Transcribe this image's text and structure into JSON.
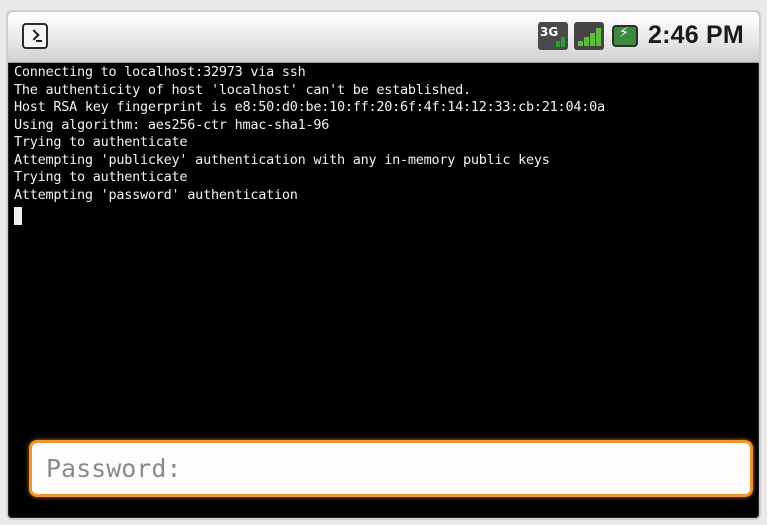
{
  "status_bar": {
    "notification_icon": "terminal-icon",
    "network_label": "3G",
    "signal_icon": "signal-bars-icon",
    "battery_icon": "battery-charging-icon",
    "time": "2:46 PM"
  },
  "terminal": {
    "lines": [
      "Connecting to localhost:32973 via ssh",
      "The authenticity of host 'localhost' can't be established.",
      "Host RSA key fingerprint is e8:50:d0:be:10:ff:20:6f:4f:14:12:33:cb:21:04:0a",
      "Using algorithm: aes256-ctr hmac-sha1-96",
      "Trying to authenticate",
      "Attempting 'publickey' authentication with any in-memory public keys",
      "Trying to authenticate",
      "Attempting 'password' authentication"
    ]
  },
  "password_field": {
    "placeholder": "Password:",
    "value": "",
    "accent_color": "#f0962d"
  }
}
